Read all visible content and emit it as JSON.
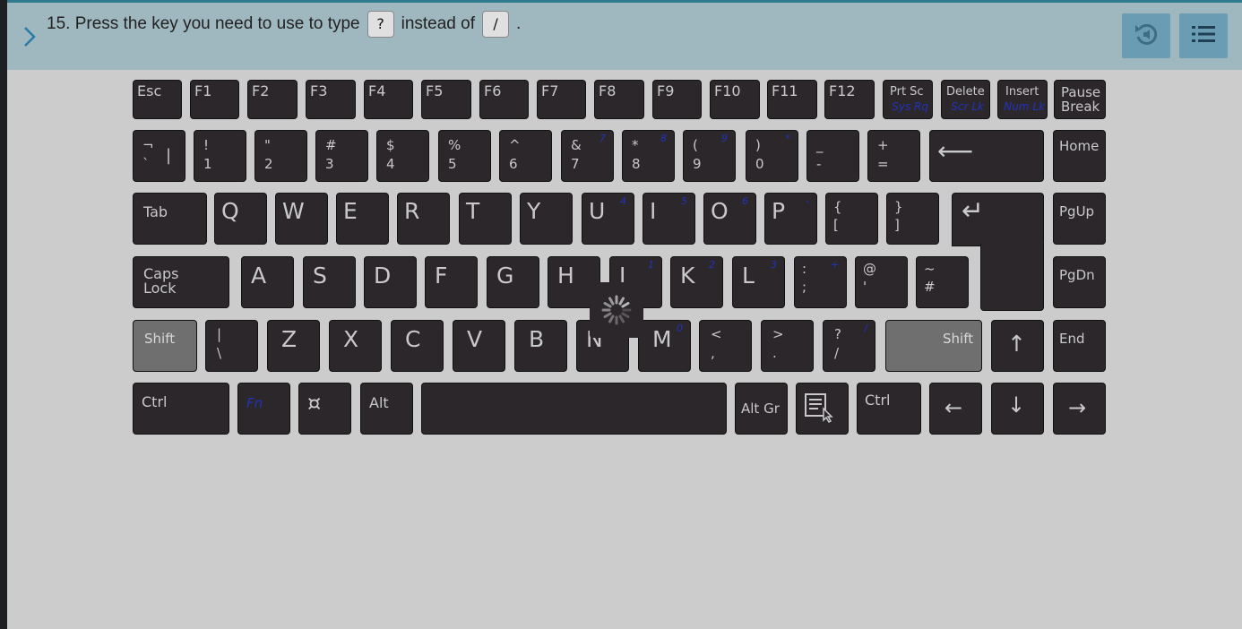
{
  "header": {
    "question_prefix": "15. Press the key you need to use to type",
    "key_target": "?",
    "question_middle": "instead of",
    "key_current": "/",
    "question_suffix": ".",
    "expand_icon": "chevron-right-icon",
    "replay_icon": "replay-audio-icon",
    "menu_icon": "list-menu-icon"
  },
  "colors": {
    "header_bg": "#9fb7bf",
    "key_bg": "#2b272b",
    "shift_highlight": "#6f6f6f",
    "secondary_legend": "#2233bb"
  },
  "keyboard": {
    "row_f": [
      "Esc",
      "F1",
      "F2",
      "F3",
      "F4",
      "F5",
      "F6",
      "F7",
      "F8",
      "F9",
      "F10",
      "F11",
      "F12"
    ],
    "prtsc": {
      "main": "Prt Sc",
      "sub": "Sys Rq"
    },
    "delete": {
      "main": "Delete",
      "sub": "Scr Lk"
    },
    "insert": {
      "main": "Insert",
      "sub": "Num Lk"
    },
    "pause": {
      "top": "Pause",
      "bottom": "Break"
    },
    "row_num": [
      {
        "top": "¬",
        "bottom": "`",
        "right": "|"
      },
      {
        "top": "!",
        "bottom": "1"
      },
      {
        "top": "\"",
        "bottom": "2"
      },
      {
        "top": "#",
        "bottom": "3"
      },
      {
        "top": "$",
        "bottom": "4"
      },
      {
        "top": "%",
        "bottom": "5"
      },
      {
        "top": "^",
        "bottom": "6"
      },
      {
        "top": "&",
        "bottom": "7",
        "sec": "7"
      },
      {
        "top": "*",
        "bottom": "8",
        "sec": "8"
      },
      {
        "top": "(",
        "bottom": "9",
        "sec": "9"
      },
      {
        "top": ")",
        "bottom": "0",
        "sec": "*"
      },
      {
        "top": "_",
        "bottom": "-"
      },
      {
        "top": "+",
        "bottom": "="
      }
    ],
    "backspace": "⟵",
    "home": "Home",
    "tab": "Tab",
    "row_q": [
      {
        "main": "Q"
      },
      {
        "main": "W"
      },
      {
        "main": "E"
      },
      {
        "main": "R"
      },
      {
        "main": "T"
      },
      {
        "main": "Y"
      },
      {
        "main": "U",
        "sec": "4"
      },
      {
        "main": "I",
        "sec": "5"
      },
      {
        "main": "O",
        "sec": "6"
      },
      {
        "main": "P",
        "sec": "-"
      },
      {
        "top": "{",
        "bottom": "["
      },
      {
        "top": "}",
        "bottom": "]"
      }
    ],
    "enter": "↵",
    "pgup": "PgUp",
    "capslock": {
      "top": "Caps",
      "bottom": "Lock"
    },
    "row_a": [
      {
        "main": "A"
      },
      {
        "main": "S"
      },
      {
        "main": "D"
      },
      {
        "main": "F"
      },
      {
        "main": "G"
      },
      {
        "main": "H"
      },
      {
        "main": "J",
        "sec": "1"
      },
      {
        "main": "K",
        "sec": "2"
      },
      {
        "main": "L",
        "sec": "3"
      },
      {
        "top": ":",
        "bottom": ";",
        "sec": "+"
      },
      {
        "top": "@",
        "bottom": "'"
      },
      {
        "top": "~",
        "bottom": "#"
      }
    ],
    "pgdn": "PgDn",
    "lshift": "Shift",
    "row_z": [
      {
        "top": "|",
        "bottom": "\\"
      },
      {
        "main": "Z"
      },
      {
        "main": "X"
      },
      {
        "main": "C"
      },
      {
        "main": "V"
      },
      {
        "main": "B"
      },
      {
        "main": "N"
      },
      {
        "main": "M",
        "sec": "0"
      },
      {
        "top": "<",
        "bottom": ","
      },
      {
        "top": ">",
        "bottom": "."
      },
      {
        "top": "?",
        "bottom": "/",
        "sec": "/"
      }
    ],
    "rshift": "Shift",
    "arrow_up": "↑",
    "end": "End",
    "ctrl_left": "Ctrl",
    "fn": "Fn",
    "win_symbol": "¤",
    "alt": "Alt",
    "altgr": "Alt Gr",
    "ctrl_right": "Ctrl",
    "arrow_left": "←",
    "arrow_down": "↓",
    "arrow_right": "→"
  }
}
